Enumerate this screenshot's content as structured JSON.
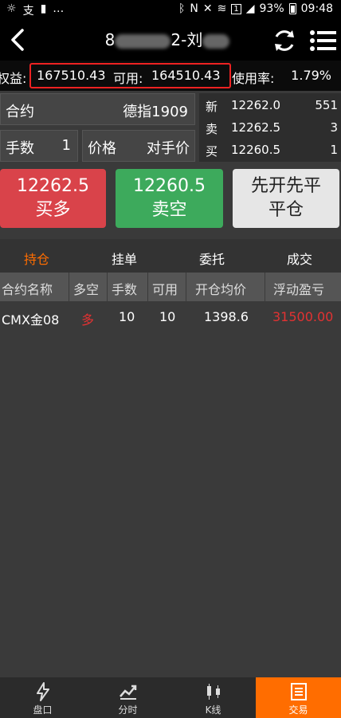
{
  "status": {
    "battery": "93%",
    "time": "09:48",
    "sim": "1"
  },
  "nav": {
    "title_prefix": "8",
    "title_suffix": "2-刘"
  },
  "account": {
    "equity_label": "权益:",
    "equity_value": "167510.43",
    "available_label": "可用:",
    "available_value": "164510.43",
    "usage_label": "使用率:",
    "usage_value": "1.79%"
  },
  "order": {
    "contract_label": "合约",
    "contract_value": "德指1909",
    "qty_label": "手数",
    "qty_value": "1",
    "price_label": "价格",
    "price_value": "对手价"
  },
  "quote": {
    "rows": [
      {
        "label": "新",
        "price": "12262.0",
        "qty": "551"
      },
      {
        "label": "卖",
        "price": "12262.5",
        "qty": "3"
      },
      {
        "label": "买",
        "price": "12260.5",
        "qty": "1"
      }
    ]
  },
  "actions": {
    "buy_price": "12262.5",
    "buy_label": "买多",
    "sell_price": "12260.5",
    "sell_label": "卖空",
    "close_line1": "先开先平",
    "close_line2": "平仓"
  },
  "tabs": [
    "持仓",
    "挂单",
    "委托",
    "成交"
  ],
  "positions": {
    "columns": [
      "合约名称",
      "多空",
      "手数",
      "可用",
      "开仓均价",
      "浮动盈亏"
    ],
    "rows": [
      {
        "contract": "CMX金08",
        "side": "多",
        "qty": "10",
        "available": "10",
        "avg_price": "1398.6",
        "pnl": "31500.00"
      }
    ]
  },
  "bottom_nav": [
    "盘口",
    "分时",
    "K线",
    "交易"
  ],
  "colors": {
    "accent": "#ff6d00",
    "buy": "#d9434a",
    "sell": "#3daa5c",
    "highlight_border": "#ee2222"
  }
}
